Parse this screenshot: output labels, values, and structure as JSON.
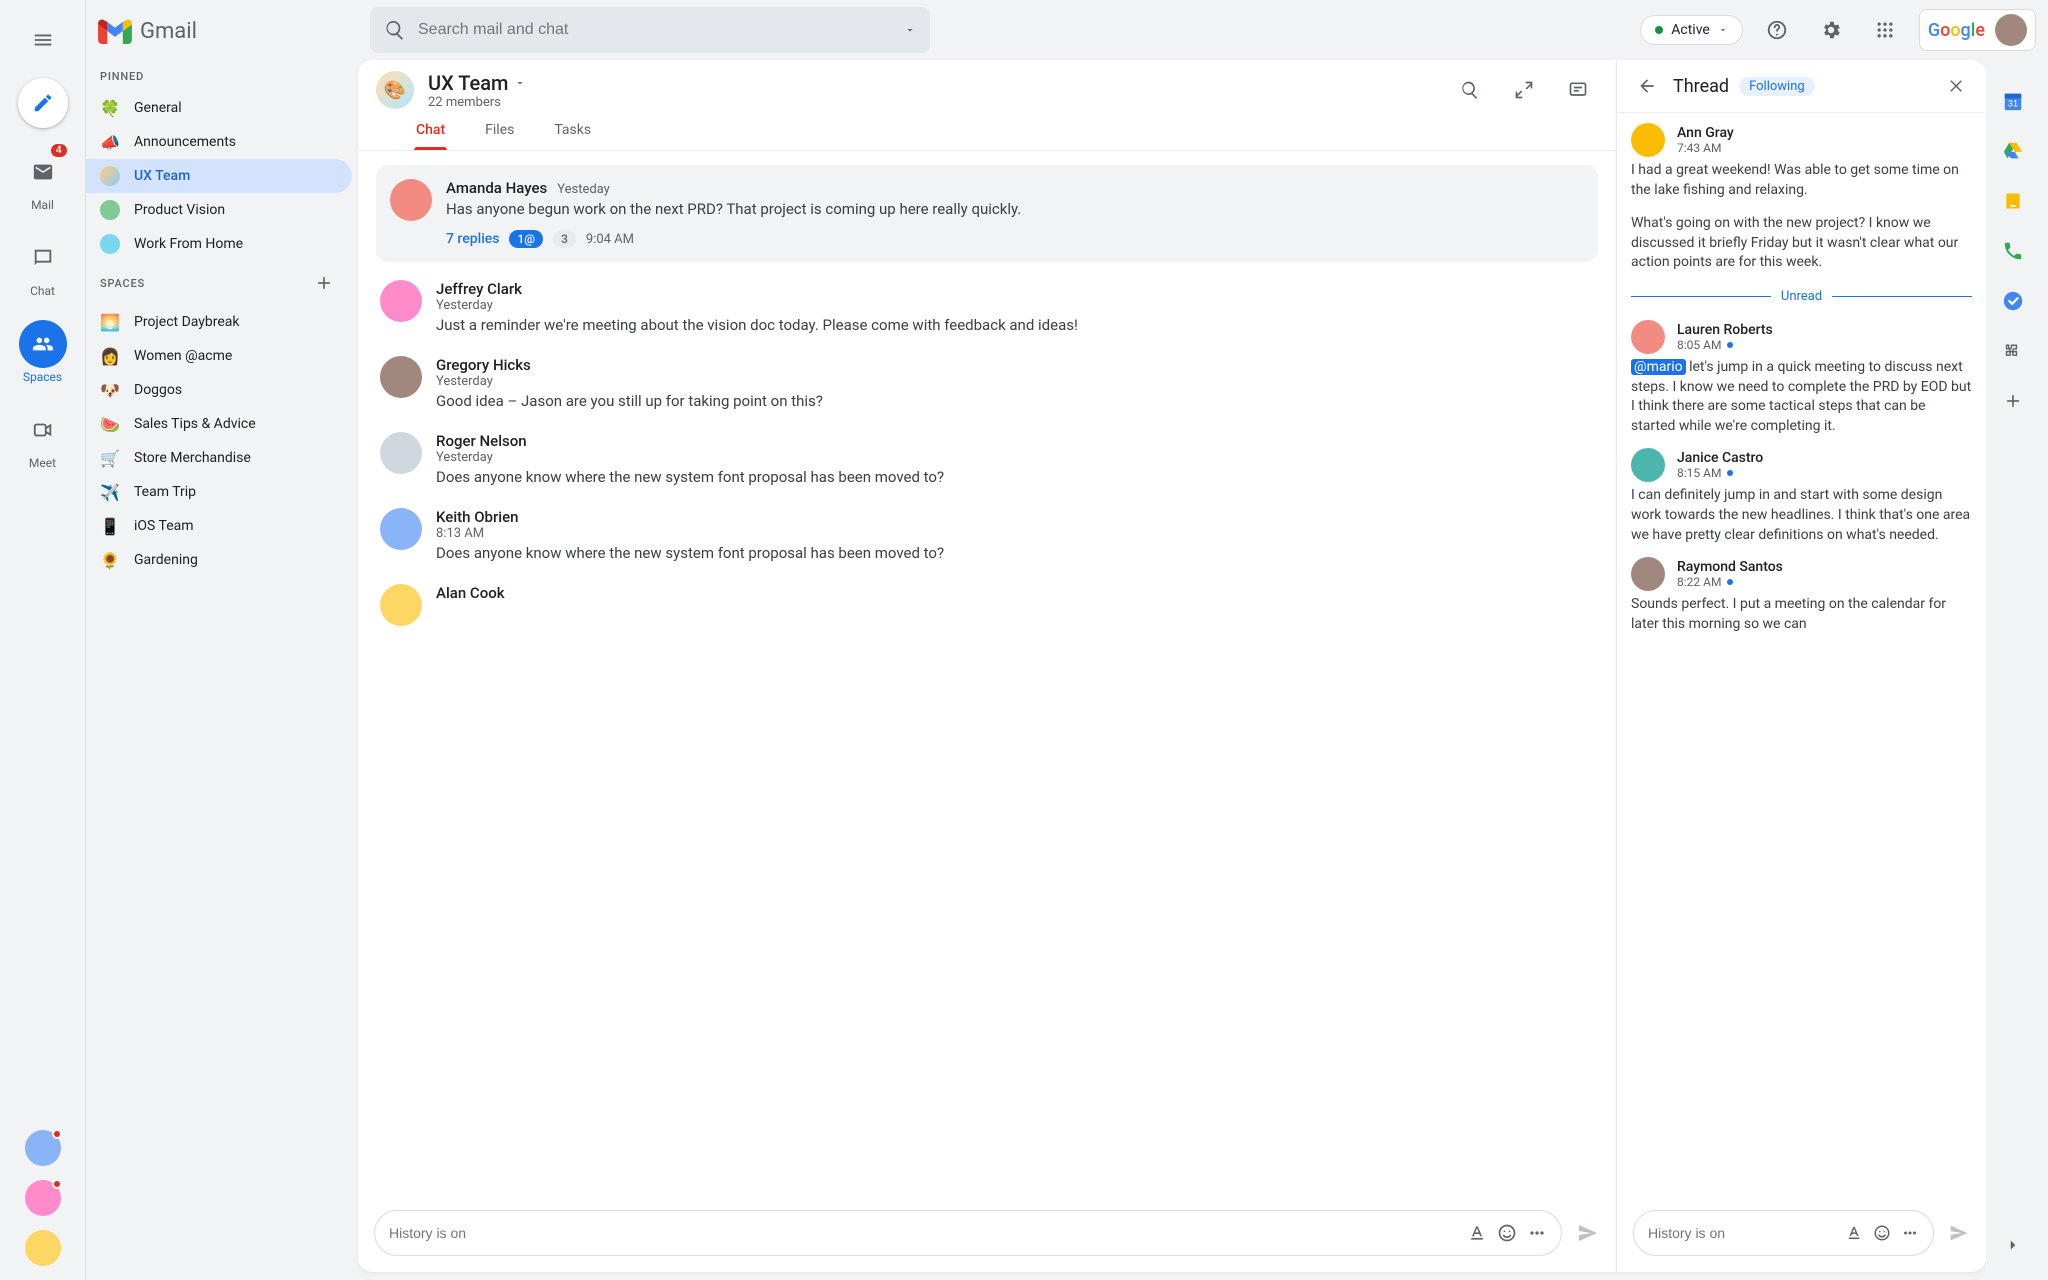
{
  "brand": "Gmail",
  "search": {
    "placeholder": "Search mail and chat"
  },
  "status": {
    "label": "Active"
  },
  "rail": {
    "mail": {
      "label": "Mail",
      "badge": "4"
    },
    "chat": {
      "label": "Chat"
    },
    "spaces": {
      "label": "Spaces"
    },
    "meet": {
      "label": "Meet"
    }
  },
  "sidebar": {
    "pinned_label": "PINNED",
    "spaces_label": "SPACES",
    "pinned": [
      {
        "emoji": "🍀",
        "label": "General"
      },
      {
        "emoji": "📣",
        "label": "Announcements"
      },
      {
        "emoji": "🎨",
        "label": "UX Team",
        "active": true,
        "isAvatar": true
      },
      {
        "emoji": "💡",
        "label": "Product Vision",
        "isAvatar": true
      },
      {
        "emoji": "🏠",
        "label": "Work From Home",
        "isAvatar": true
      }
    ],
    "spaces": [
      {
        "emoji": "🌅",
        "label": "Project Daybreak"
      },
      {
        "emoji": "👩",
        "label": "Women @acme"
      },
      {
        "emoji": "🐶",
        "label": "Doggos"
      },
      {
        "emoji": "🍉",
        "label": "Sales Tips & Advice"
      },
      {
        "emoji": "🛒",
        "label": "Store Merchandise"
      },
      {
        "emoji": "✈️",
        "label": "Team Trip"
      },
      {
        "emoji": "📱",
        "label": "iOS Team"
      },
      {
        "emoji": "🌻",
        "label": "Gardening"
      }
    ]
  },
  "space": {
    "name": "UX Team",
    "members": "22 members",
    "tabs": {
      "chat": "Chat",
      "files": "Files",
      "tasks": "Tasks"
    },
    "pinned_msg": {
      "name": "Amanda Hayes",
      "time": "Yesteday",
      "text": "Has anyone begun work on the next PRD? That project is coming up here really quickly.",
      "replies_label": "7 replies",
      "mention_pill": "1@",
      "count_pill": "3",
      "reply_time": "9:04 AM"
    },
    "messages": [
      {
        "name": "Jeffrey Clark",
        "time": "Yesterday",
        "text": "Just a reminder we're meeting about the vision doc today. Please come with feedback and ideas!"
      },
      {
        "name": "Gregory Hicks",
        "time": "Yesterday",
        "text": "Good idea – Jason are you still up for taking point on this?"
      },
      {
        "name": "Roger Nelson",
        "time": "Yesterday",
        "text": "Does anyone know where the new system font proposal has been moved to?"
      },
      {
        "name": "Keith Obrien",
        "time": "8:13 AM",
        "text": "Does anyone know where the new system font proposal has been moved to?"
      },
      {
        "name": "Alan Cook",
        "time": "",
        "text": ""
      }
    ],
    "composer_placeholder": "History is on"
  },
  "thread": {
    "title": "Thread",
    "following": "Following",
    "unread_label": "Unread",
    "composer_placeholder": "History is on",
    "top": {
      "name": "Ann Gray",
      "time": "7:43 AM",
      "text1": "I had a great weekend! Was able to get some time on the lake fishing and relaxing.",
      "text2": "What's going on with the new project? I know we discussed it briefly Friday but it wasn't clear what our action points are for this week."
    },
    "messages": [
      {
        "name": "Lauren Roberts",
        "time": "8:05 AM",
        "mention": "@mario",
        "text": " let's jump in a quick meeting to discuss next steps. I know we need to complete the PRD by EOD but I think there are some tactical steps that can be started while we're completing it."
      },
      {
        "name": "Janice Castro",
        "time": "8:15 AM",
        "text": "I can definitely jump in and start with some design work towards the new headlines. I think that's one area we have pretty clear definitions on what's needed."
      },
      {
        "name": "Raymond Santos",
        "time": "8:22 AM",
        "text": "Sounds perfect. I put a meeting on the calendar for later this morning so we can"
      }
    ]
  }
}
